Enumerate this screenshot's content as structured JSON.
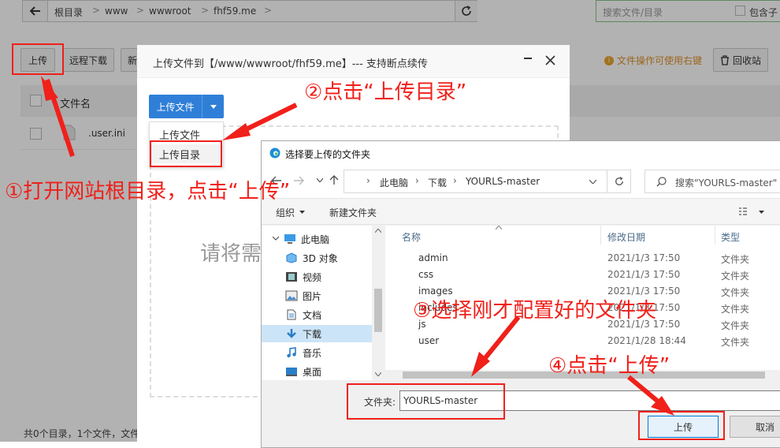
{
  "filemanager": {
    "crumbs": [
      "根目录",
      "www",
      "wwwroot",
      "fhf59.me"
    ],
    "search_placeholder": "搜索文件/目录",
    "include_sub": "包含子",
    "buttons": {
      "upload": "上传",
      "remote_download": "远程下载",
      "new": "新"
    },
    "tip": "文件操作可使用右键",
    "recycle": "回收站",
    "col_name": "文件名",
    "file_row": ".user.ini",
    "footer": "共0个目录，1个文件，文件"
  },
  "upload_dialog": {
    "title": "上传文件到【/www/wwwroot/fhf59.me】--- 支持断点续传",
    "upload_file_btn": "上传文件",
    "menu": [
      "上传文件",
      "上传目录"
    ],
    "drop_hint": "请将需"
  },
  "win_dialog": {
    "title": "选择要上传的文件夹",
    "address": [
      "此电脑",
      "下载",
      "YOURLS-master"
    ],
    "search_placeholder": "搜索\"YOURLS-master\"",
    "organize": "组织",
    "new_folder": "新建文件夹",
    "tree": [
      "此电脑",
      "3D 对象",
      "视频",
      "图片",
      "文档",
      "下载",
      "音乐",
      "桌面"
    ],
    "columns": {
      "name": "名称",
      "date": "修改日期",
      "type": "类型"
    },
    "files": [
      {
        "name": "admin",
        "date": "2021/1/3 17:50",
        "type": "文件夹"
      },
      {
        "name": "css",
        "date": "2021/1/3 17:50",
        "type": "文件夹"
      },
      {
        "name": "images",
        "date": "2021/1/3 17:50",
        "type": "文件夹"
      },
      {
        "name": "includes",
        "date": "2021/1/3 17:50",
        "type": "文件夹"
      },
      {
        "name": "js",
        "date": "2021/1/3 17:50",
        "type": "文件夹"
      },
      {
        "name": "user",
        "date": "2021/1/28 18:44",
        "type": "文件夹"
      }
    ],
    "folder_label": "文件夹:",
    "folder_value": "YOURLS-master",
    "upload_btn": "上传",
    "cancel_btn": "取消"
  },
  "annotations": {
    "step1": "①打开网站根目录，点击“上传”",
    "step2": "②点击“上传目录”",
    "step3": "③选择刚才配置好的文件夹",
    "step4": "④点击“上传”"
  },
  "colors": {
    "accent": "#2f7fd8",
    "annotation_red": "#f0201a",
    "folder_yellow": "#f5c74f"
  }
}
